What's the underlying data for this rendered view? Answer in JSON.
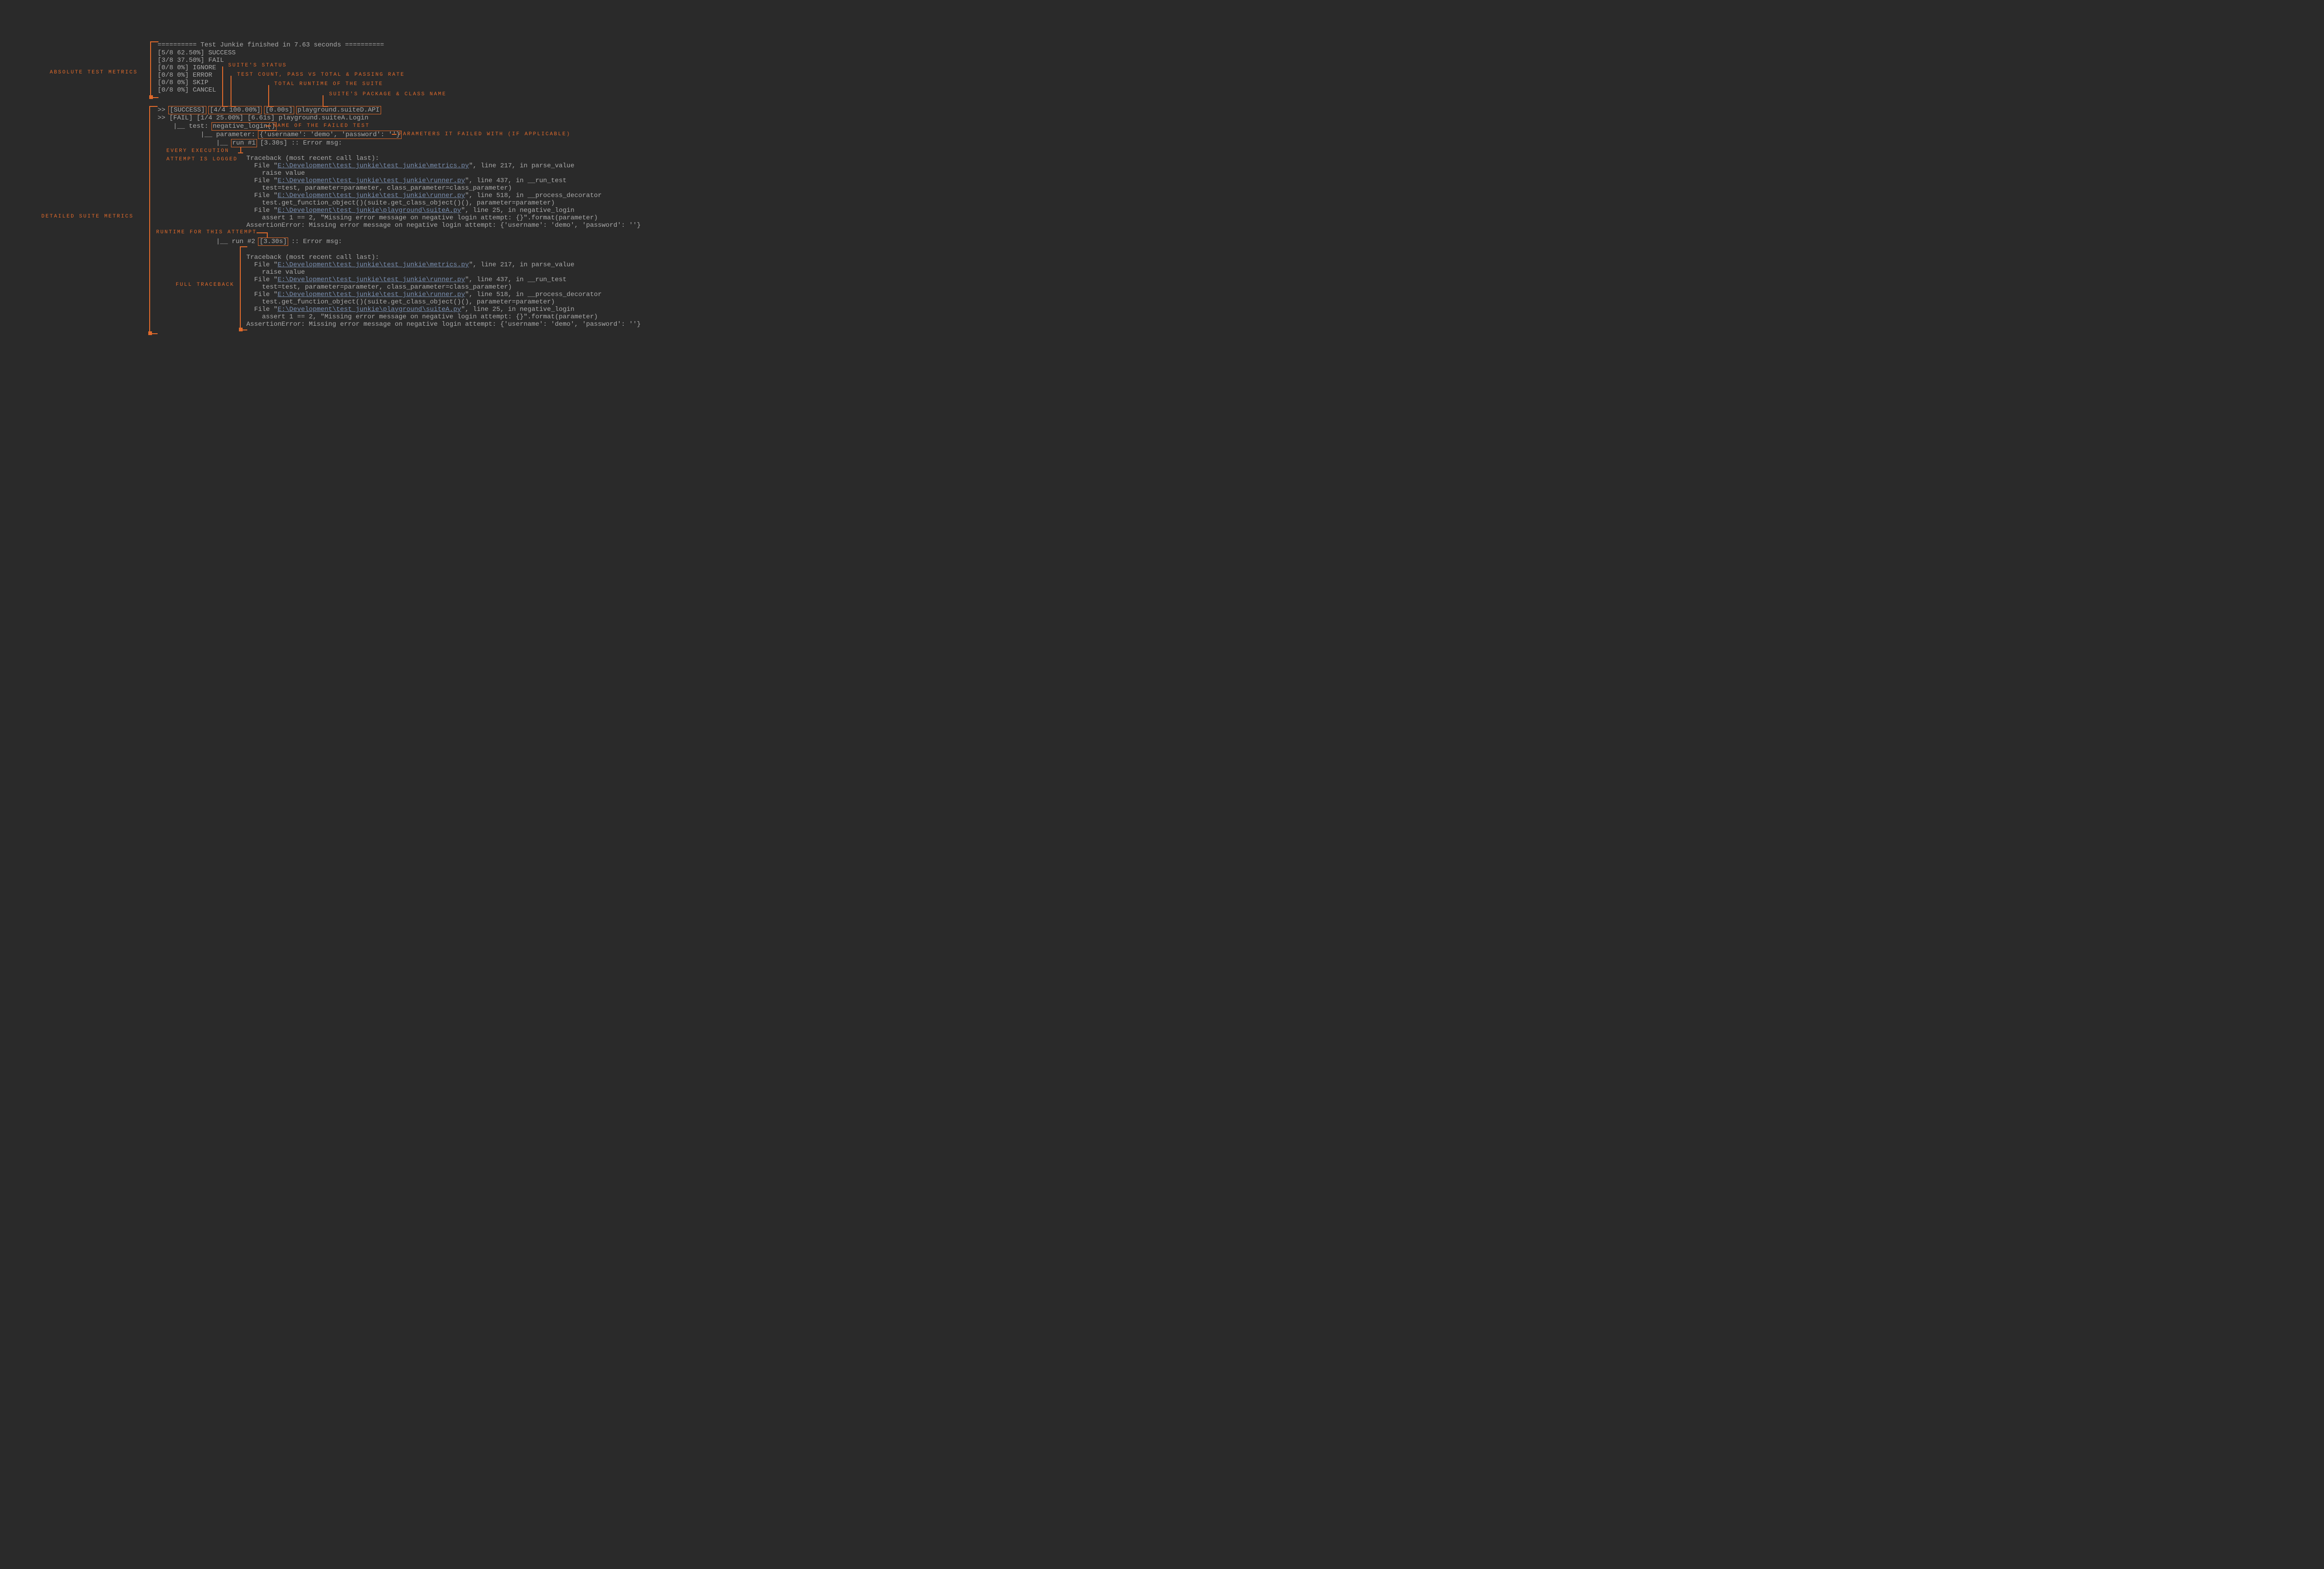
{
  "header": "========== Test Junkie finished in 7.63 seconds ==========",
  "metrics": [
    "[5/8 62.50%] SUCCESS",
    "[3/8 37.50%] FAIL",
    "[0/8 0%] IGNORE",
    "[0/8 0%] ERROR",
    "[0/8 0%] SKIP",
    "[0/8 0%] CANCEL"
  ],
  "labels": {
    "absolute": "ABSOLUTE TEST METRICS",
    "suite_status": "SUITE'S STATUS",
    "count_rate": "TEST COUNT, PASS VS TOTAL & PASSING RATE",
    "runtime": "TOTAL RUNTIME OF THE SUITE",
    "pkg_class": "SUITE'S PACKAGE & CLASS NAME",
    "failed_name": "NAME OF THE FAILED TEST",
    "params": "PARAMETERS IT FAILED WITH (IF APPLICABLE)",
    "every_exec1": "EVERY EXECUTION",
    "every_exec2": "ATTEMPT IS LOGGED",
    "detailed": "DETAILED SUITE METRICS",
    "runtime_attempt": "RUNTIME FOR THIS ATTEMPT",
    "full_tb": "FULL TRACEBACK"
  },
  "suite_success": {
    "status": "[SUCCESS]",
    "count": "[4/4 100.00%]",
    "time": "[0.00s]",
    "pkg": "playground.suiteD.API"
  },
  "suite_fail_line": ">> [FAIL] [1/4 25.00%] [6.61s] playground.suiteA.Login",
  "test_line": "    |__ test: negative_login()",
  "param_line_pre": "           |__ parameter: {'username': 'demo', 'password': ''}",
  "run1_pre": "               |__",
  "run1_label": "run #1",
  "run1_post": "[3.30s] :: Error msg:",
  "run2_pre": "               |__ run #2",
  "run2_time": "[3.30s]",
  "run2_post": " :: Error msg:",
  "tb": {
    "tb_head": "Traceback (most recent call last):",
    "f1a": "  File \"",
    "f1p": "E:\\Development\\test_junkie\\test_junkie\\metrics.py",
    "f1b": "\", line 217, in parse_value",
    "f1c": "    raise value",
    "f2a": "  File \"",
    "f2p": "E:\\Development\\test_junkie\\test_junkie\\runner.py",
    "f2b": "\", line 437, in __run_test",
    "f2c": "    test=test, parameter=parameter, class_parameter=class_parameter)",
    "f3a": "  File \"",
    "f3p": "E:\\Development\\test_junkie\\test_junkie\\runner.py",
    "f3b": "\", line 518, in __process_decorator",
    "f3c": "    test.get_function_object()(suite.get_class_object()(), parameter=parameter)",
    "f4a": "  File \"",
    "f4p": "E:\\Development\\test_junkie\\playground\\suiteA.py",
    "f4b": "\", line 25, in negative_login",
    "f4c": "    assert 1 == 2, \"Missing error message on negative login attempt: {}\".format(parameter)",
    "err": "AssertionError: Missing error message on negative login attempt: {'username': 'demo', 'password': ''}"
  }
}
